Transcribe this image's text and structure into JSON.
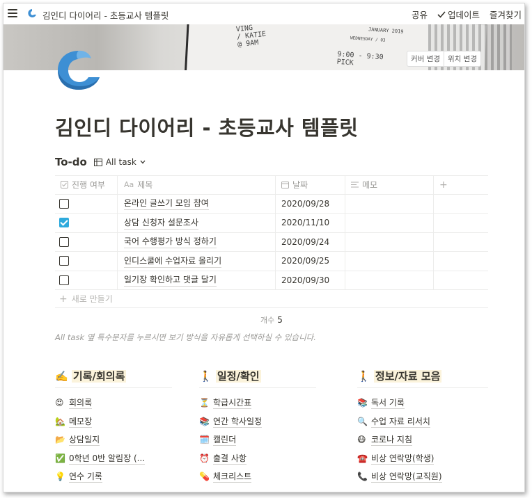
{
  "topbar": {
    "page_path": "김인디 다이어리 - 초등교사 템플릿",
    "share": "공유",
    "updates": "업데이트",
    "favorites": "즐겨찾기"
  },
  "cover": {
    "change_cover": "커버 변경",
    "reposition": "위치 변경",
    "scribble_1": "VING\n/ KATIE\n@ 9AM",
    "scribble_2": "JANUARY 2019",
    "scribble_3": "WEDNESDAY / 03",
    "scribble_4": "9:00 - 9:30\nPICK"
  },
  "page": {
    "title": "김인디 다이어리 - 초등교사 템플릿"
  },
  "database": {
    "title": "To-do",
    "view_name": "All task",
    "columns": [
      "진행 여부",
      "제목",
      "날짜",
      "메모"
    ],
    "column_icons": [
      "checkbox-icon",
      "text-icon",
      "calendar-icon",
      "lines-icon"
    ],
    "rows": [
      {
        "done": false,
        "title": "온라인 글쓰기 모임 참여",
        "date": "2020/09/28"
      },
      {
        "done": true,
        "title": "상담 신청자 설문조사",
        "date": "2020/11/10"
      },
      {
        "done": false,
        "title": "국어 수행평가 방식 정하기",
        "date": "2020/09/24"
      },
      {
        "done": false,
        "title": "인디스쿨에 수업자료 올리기",
        "date": "2020/09/25"
      },
      {
        "done": false,
        "title": "일기장 확인하고 댓글 달기",
        "date": "2020/09/30"
      }
    ],
    "new_label": "새로 만들기",
    "count_label": "개수",
    "count_value": "5"
  },
  "note": "All task 옆 특수문자를 누르시면 보기 방식을 자유롭게 선택하실 수 있습니다.",
  "sections": [
    {
      "icon": "✍️",
      "title": "기록/회의록",
      "items": [
        {
          "icon": "😍",
          "label": "회의록"
        },
        {
          "icon": "🏡",
          "label": "메모장"
        },
        {
          "icon": "📂",
          "label": "상담일지"
        },
        {
          "icon": "✅",
          "label": "0학년 0반 알림장 (..."
        },
        {
          "icon": "💡",
          "label": "연수 기록"
        }
      ]
    },
    {
      "icon": "🚶",
      "title": "일정/확인",
      "items": [
        {
          "icon": "⏳",
          "label": "학급시간표"
        },
        {
          "icon": "📚",
          "label": "연간 학사일정"
        },
        {
          "icon": "🗓️",
          "label": "캘린더"
        },
        {
          "icon": "⏰",
          "label": "출결 사항"
        },
        {
          "icon": "💊",
          "label": "체크리스트"
        }
      ]
    },
    {
      "icon": "🚶",
      "title": "정보/자료 모음",
      "items": [
        {
          "icon": "📚",
          "label": "독서 기록"
        },
        {
          "icon": "🔍",
          "label": "수업 자료 리서치"
        },
        {
          "icon": "😷",
          "label": "코로나 지침"
        },
        {
          "icon": "☎️",
          "label": "비상 연락망(학생)"
        },
        {
          "icon": "📞",
          "label": "비상 연락망(교직원)"
        }
      ]
    }
  ],
  "colors": {
    "accent": "#2eaadc",
    "logo_blue": "#3d8fd4",
    "highlight": "#fbf3db"
  }
}
